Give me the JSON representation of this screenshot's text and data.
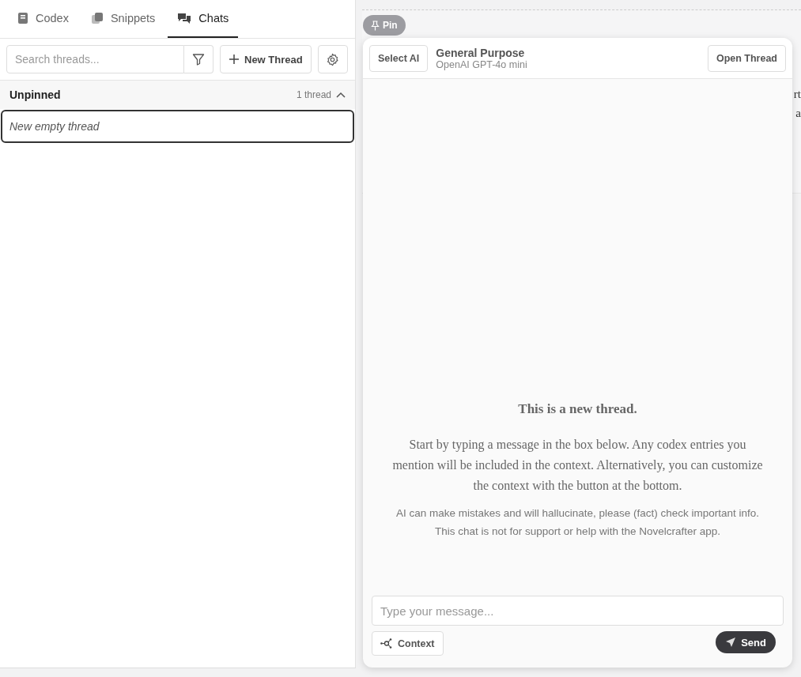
{
  "tabs": [
    {
      "label": "Codex",
      "kind": "book",
      "selected": false
    },
    {
      "label": "Snippets",
      "kind": "copy",
      "selected": false
    },
    {
      "label": "Chats",
      "kind": "chat",
      "selected": true
    }
  ],
  "search": {
    "placeholder": "Search threads..."
  },
  "new_thread_button": "New Thread",
  "group": {
    "title": "Unpinned",
    "count": "1 thread",
    "expanded": true
  },
  "threads": [
    {
      "title": "New empty thread",
      "selected": true
    }
  ],
  "background_text": [
    "rt",
    "a"
  ],
  "pin_button": "Pin",
  "chat": {
    "select_ai_button": "Select AI",
    "assistant_name": "General Purpose",
    "model": "OpenAI GPT-4o mini",
    "open_thread_button": "Open Thread",
    "empty_title": "This is a new thread.",
    "empty_body": "Start by typing a message in the box below. Any codex entries you mention will be included in the context. Alternatively, you can customize the context with the button at the bottom.",
    "disclaimer": "AI can make mistakes and will hallucinate, please (fact) check important info. This chat is not for support or help with the Novelcrafter app.",
    "message_placeholder": "Type your message...",
    "context_button": "Context",
    "send_button": "Send"
  }
}
